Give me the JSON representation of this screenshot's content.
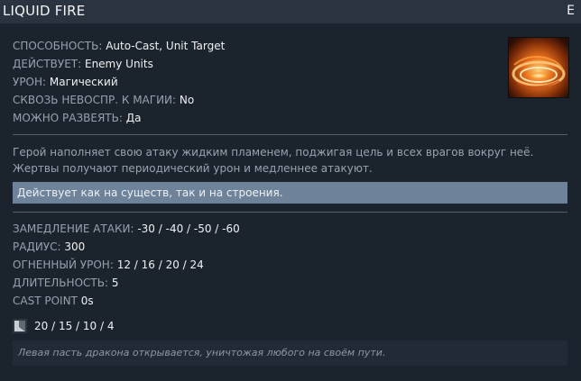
{
  "header": {
    "title": "LIQUID FIRE",
    "hotkey": "E"
  },
  "ability_icon": "liquid-fire-icon",
  "stats": [
    {
      "label": "СПОСОБНОСТЬ:",
      "value": "Auto-Cast, Unit Target"
    },
    {
      "label": "ДЕЙСТВУЕТ:",
      "value": "Enemy Units"
    },
    {
      "label": "УРОН:",
      "value": "Магический"
    },
    {
      "label": "СКВОЗЬ НЕВОСПР. К МАГИИ:",
      "value": "No"
    },
    {
      "label": "МОЖНО РАЗВЕЯТЬ:",
      "value": "Да"
    }
  ],
  "description": "Герой наполняет свою атаку жидким пламенем, поджигая цель и всех врагов вокруг неё. Жертвы получают периодический урон и медленнее атакуют.",
  "note": "Действует как на существ, так и на строения.",
  "ability_stats": [
    {
      "label": "ЗАМЕДЛЕНИЕ АТАКИ:",
      "value": "-30 / -40 / -50 / -60"
    },
    {
      "label": "РАДИУС:",
      "value": "300"
    },
    {
      "label": "ОГНЕННЫЙ УРОН:",
      "value": "12 / 16 / 20 / 24"
    },
    {
      "label": "ДЛИТЕЛЬНОСТЬ:",
      "value": "5"
    },
    {
      "label": "CAST POINT",
      "value": "0s"
    }
  ],
  "cooldown": {
    "icon": "cooldown-icon",
    "value": "20 / 15 / 10 / 4"
  },
  "lore": "Левая пасть дракона открывается, уничтожая любого на своём пути.",
  "colors": {
    "background": "#1b232c",
    "header_bg": "#2a3440",
    "label": "#98a2ac",
    "value": "#f0f2f4",
    "note_bg": "#6e8299",
    "lore_bg": "#222b35"
  }
}
